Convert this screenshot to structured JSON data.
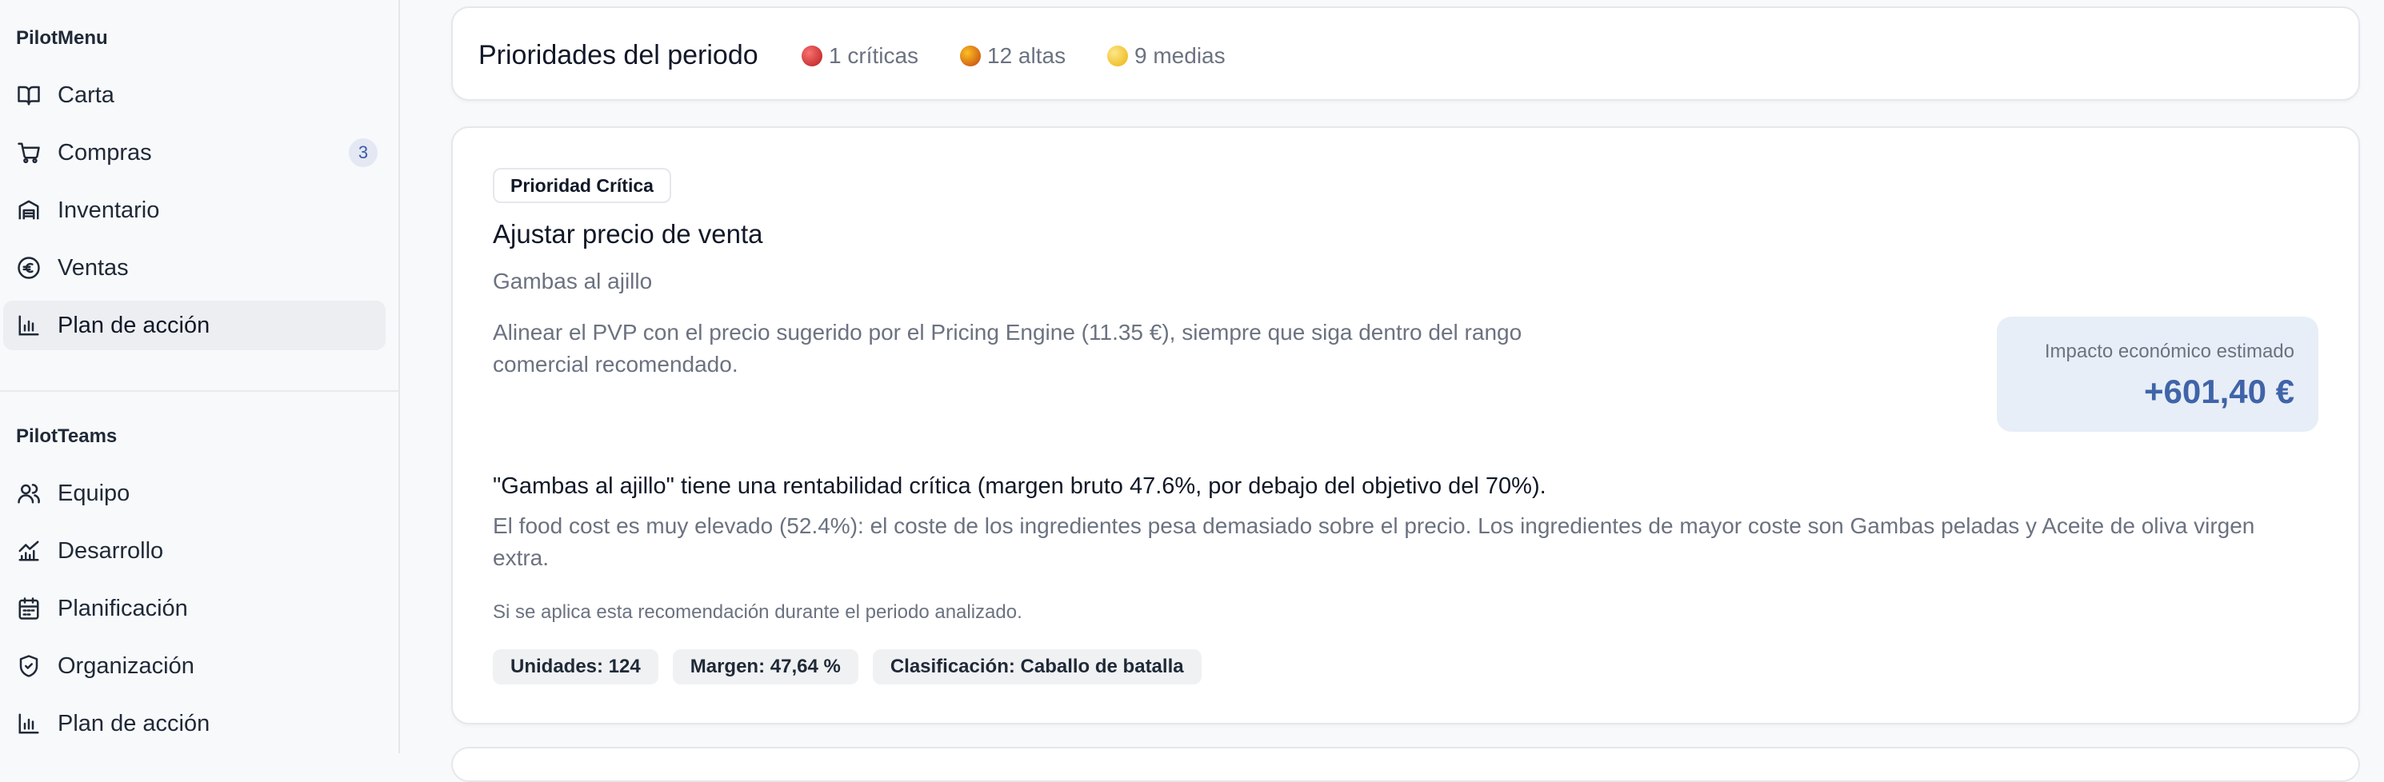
{
  "sidebar": {
    "pilotmenu_title": "PilotMenu",
    "menu_items": [
      {
        "label": "Carta",
        "icon": "book-icon"
      },
      {
        "label": "Compras",
        "icon": "cart-icon",
        "badge": "3"
      },
      {
        "label": "Inventario",
        "icon": "warehouse-icon"
      },
      {
        "label": "Ventas",
        "icon": "euro-icon"
      },
      {
        "label": "Plan de acción",
        "icon": "bar-chart-icon",
        "active": true
      }
    ],
    "pilotteams_title": "PilotTeams",
    "team_items": [
      {
        "label": "Equipo",
        "icon": "users-icon"
      },
      {
        "label": "Desarrollo",
        "icon": "trend-chart-icon"
      },
      {
        "label": "Planificación",
        "icon": "calendar-icon"
      },
      {
        "label": "Organización",
        "icon": "shield-icon"
      },
      {
        "label": "Plan de acción",
        "icon": "bar-chart-icon"
      }
    ]
  },
  "summary": {
    "title": "Prioridades del periodo",
    "criticas": "1 críticas",
    "altas": "12 altas",
    "medias": "9 medias"
  },
  "recommendation": {
    "priority": "Prioridad Crítica",
    "title": "Ajustar precio de venta",
    "subject": "Gambas al ajillo",
    "description": "Alinear el PVP con el precio sugerido por el Pricing Engine (11.35 €), siempre que siga dentro del rango comercial recomendado.",
    "impact_label": "Impacto económico estimado",
    "impact_value": "+601,40 €",
    "diagnosis_title": "\"Gambas al ajillo\" tiene una rentabilidad crítica (margen bruto 47.6%, por debajo del objetivo del 70%).",
    "diagnosis_text": "El food cost es muy elevado (52.4%): el coste de los ingredientes pesa demasiado sobre el precio. Los ingredientes de mayor coste son Gambas peladas y Aceite de oliva virgen extra.",
    "note": "Si se aplica esta recomendación durante el periodo analizado.",
    "tags": [
      "Unidades: 124",
      "Margen: 47,64 %",
      "Clasificación: Caballo de batalla"
    ]
  },
  "colors": {
    "accent": "#3f64a8",
    "critical": "#b91c1c",
    "high": "#c2410c",
    "medium": "#eab308"
  }
}
